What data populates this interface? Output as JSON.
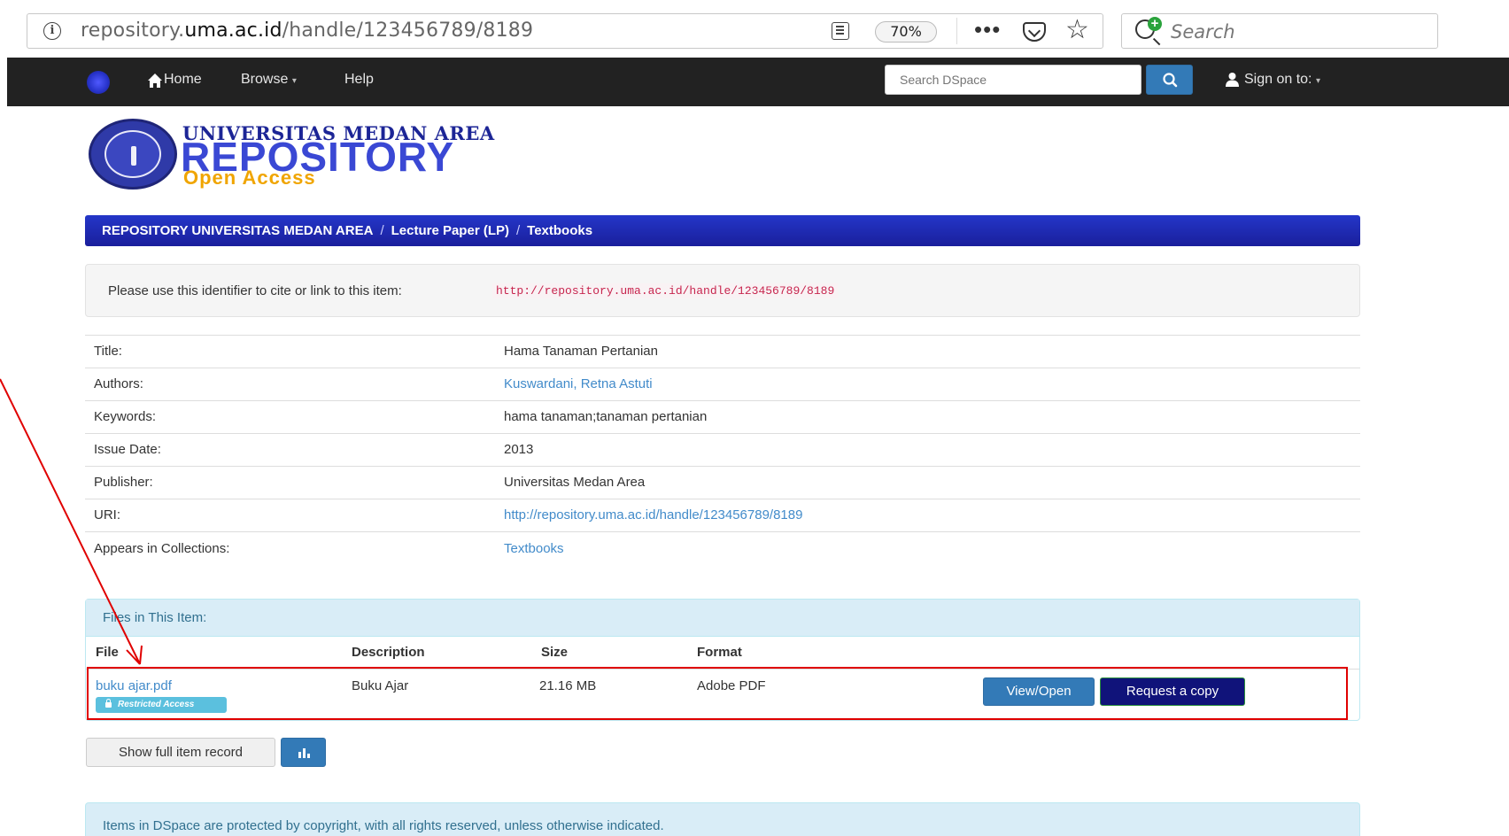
{
  "browser": {
    "url_prefix": "repository.",
    "url_host": "uma.ac.id",
    "url_path": "/handle/123456789/8189",
    "zoom": "70%",
    "more": "•••",
    "search_placeholder": "Search"
  },
  "navbar": {
    "home": "Home",
    "browse": "Browse",
    "help": "Help",
    "search_placeholder": "Search DSpace",
    "sign_on": "Sign on to:"
  },
  "brand": {
    "top": "UNIVERSITAS MEDAN AREA",
    "main": "REPOSITORY",
    "sub": "Open Access"
  },
  "breadcrumb": [
    "REPOSITORY UNIVERSITAS MEDAN AREA",
    "Lecture Paper (LP)",
    "Textbooks"
  ],
  "breadcrumb_separator": "/",
  "cite": {
    "label": "Please use this identifier to cite or link to this item:",
    "url": "http://repository.uma.ac.id/handle/123456789/8189"
  },
  "metadata": [
    {
      "label": "Title:",
      "value": "Hama Tanaman Pertanian"
    },
    {
      "label": "Authors:",
      "value": "Kuswardani, Retna Astuti"
    },
    {
      "label": "Keywords:",
      "value": "hama tanaman;tanaman pertanian"
    },
    {
      "label": "Issue Date:",
      "value": "2013"
    },
    {
      "label": "Publisher:",
      "value": "Universitas Medan Area"
    },
    {
      "label": "URI:",
      "value": "http://repository.uma.ac.id/handle/123456789/8189"
    },
    {
      "label": "Appears in Collections:",
      "value": "Textbooks"
    }
  ],
  "files": {
    "heading": "Files in This Item:",
    "columns": [
      "File",
      "Description",
      "Size",
      "Format"
    ],
    "rows": [
      {
        "file": "buku ajar.pdf",
        "badge": "Restricted Access",
        "description": "Buku Ajar",
        "size": "21.16 MB",
        "format": "Adobe PDF",
        "view_label": "View/Open",
        "request_label": "Request a copy"
      }
    ]
  },
  "actions": {
    "show_full": "Show full item record"
  },
  "footer": {
    "notice": "Items in DSpace are protected by copyright, with all rights reserved, unless otherwise indicated."
  },
  "colors": {
    "navbar_bg": "#222222",
    "breadcrumb_bg": "#1a1f9c",
    "link": "#428bca",
    "primary_button": "#337ab7",
    "request_button": "#10137a",
    "annotation_red": "#e00000",
    "info_panel": "#d9edf7"
  }
}
